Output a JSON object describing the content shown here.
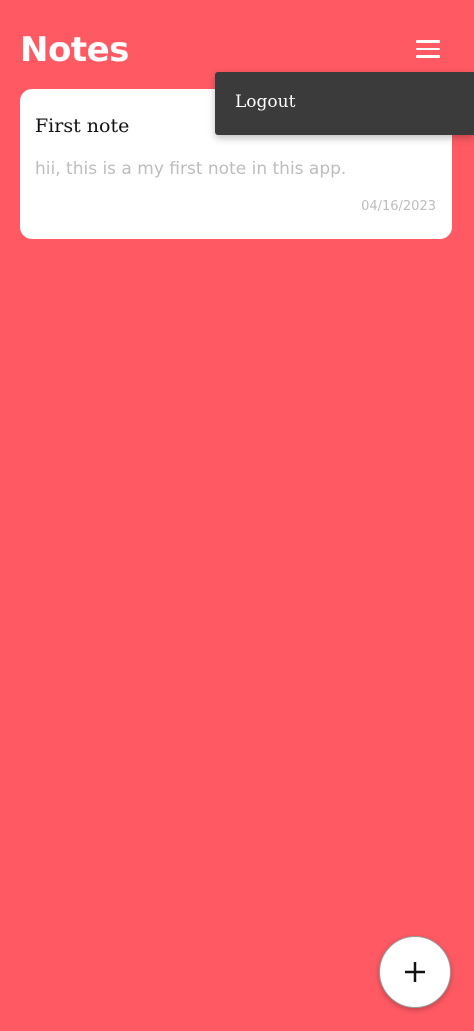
{
  "header": {
    "title": "Notes",
    "menu_icon": "hamburger-menu-icon"
  },
  "notes": [
    {
      "title": "First note",
      "body": "hii, this is a my first note in this app.",
      "date": "04/16/2023"
    }
  ],
  "menu": {
    "items": [
      {
        "label": "Logout"
      }
    ]
  },
  "fab": {
    "icon": "plus-icon"
  },
  "colors": {
    "background": "#FF5A63",
    "card": "#ffffff",
    "menu_background": "#3b3b3b"
  }
}
